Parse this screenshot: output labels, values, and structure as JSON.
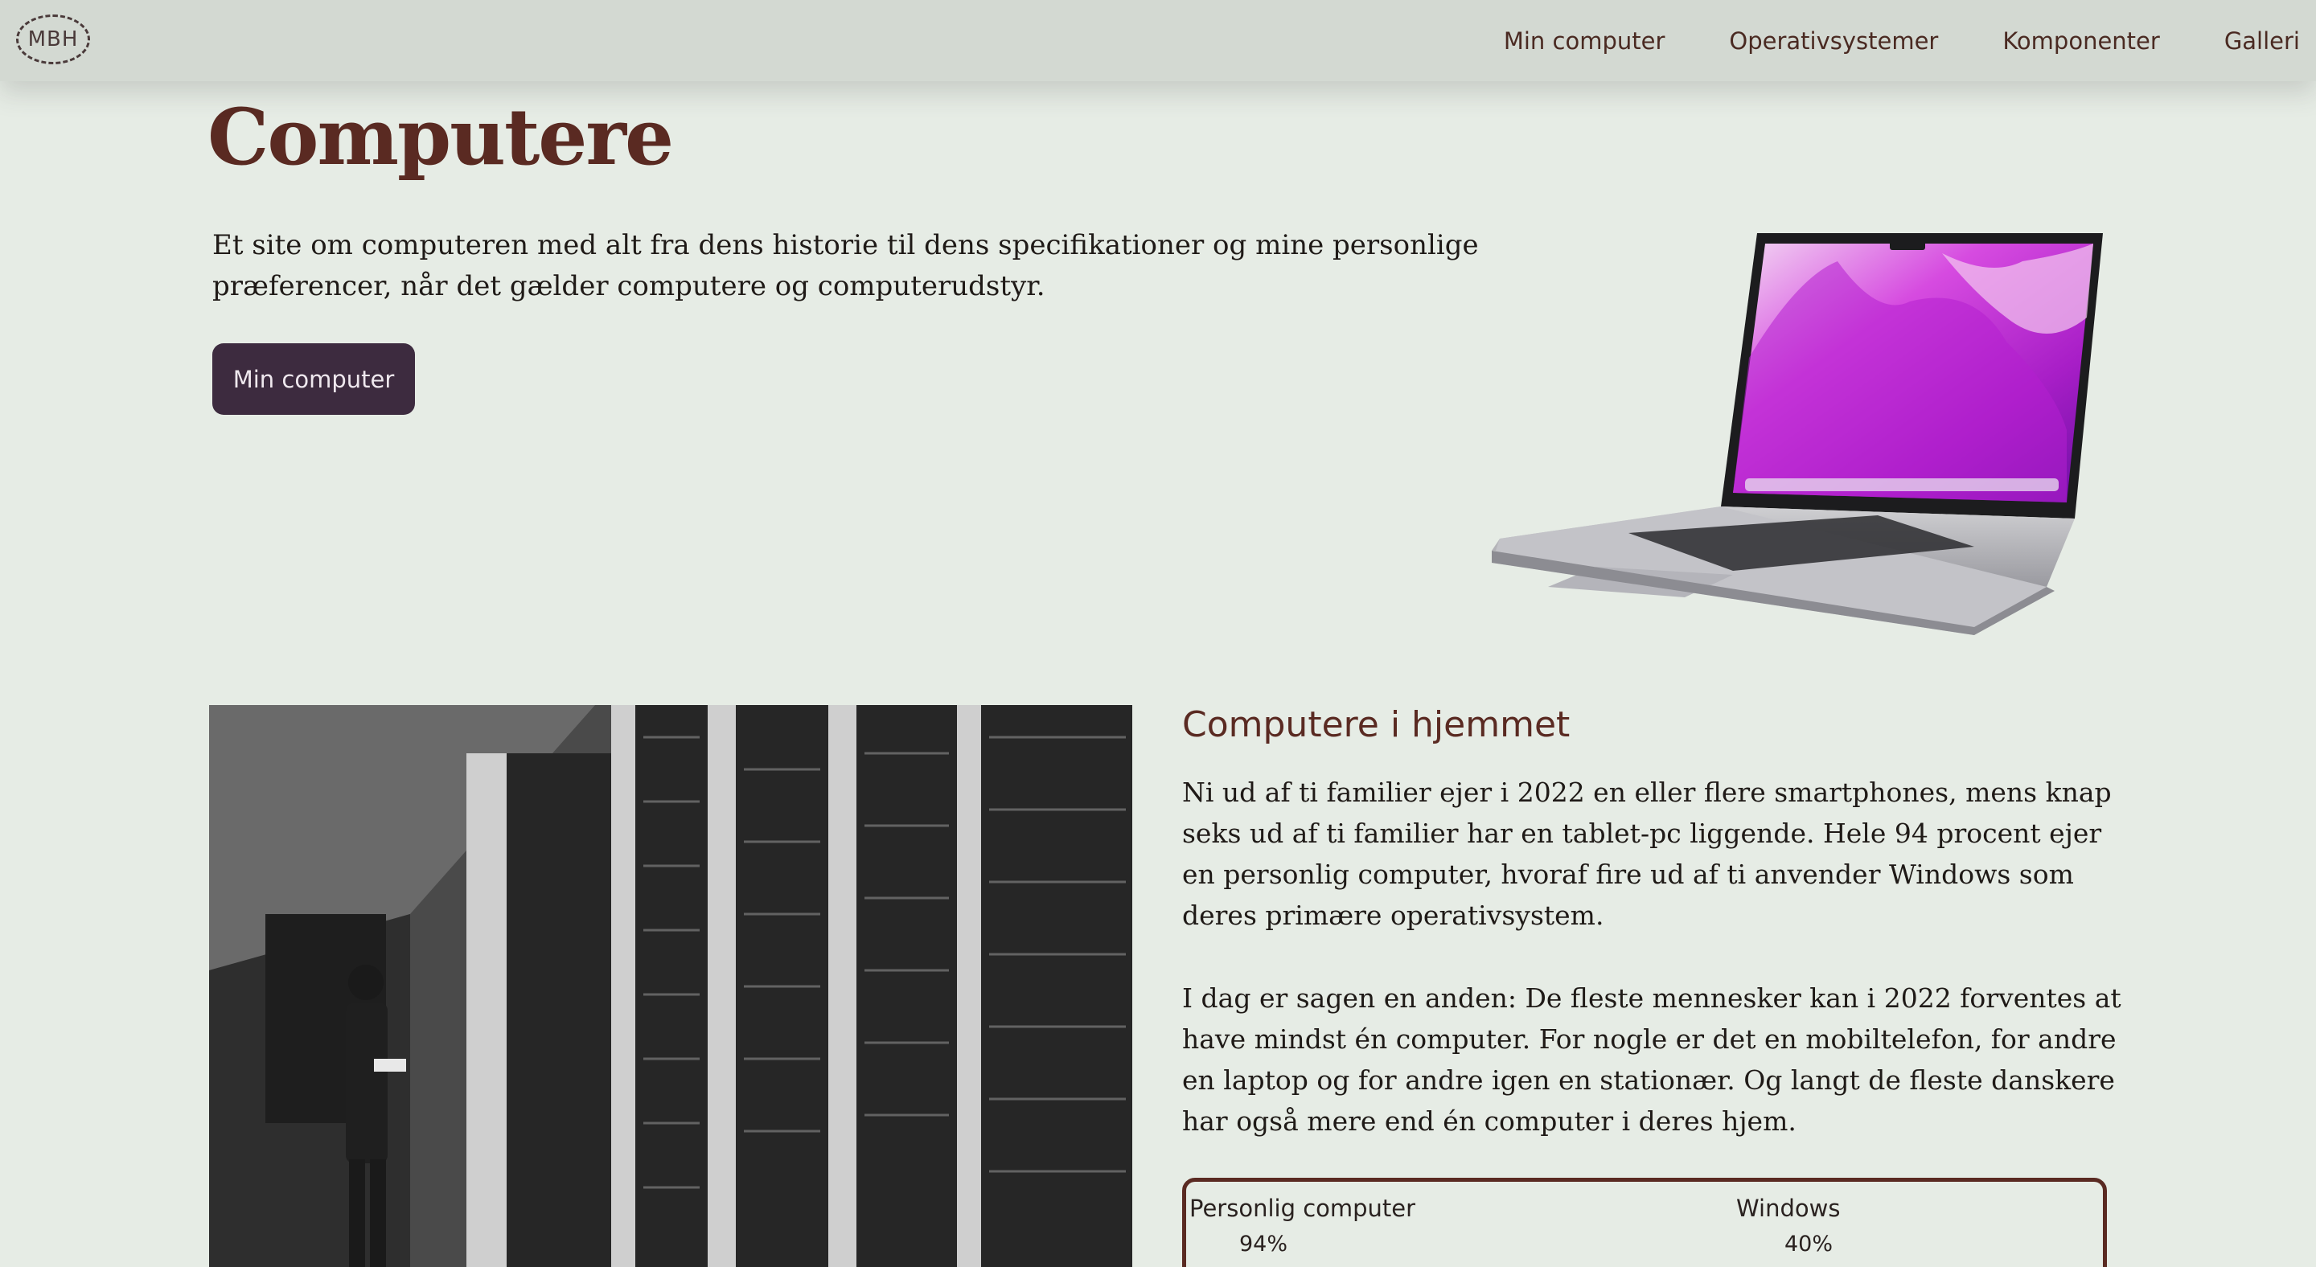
{
  "nav": {
    "logo": "MBH",
    "links": [
      "Min computer",
      "Operativsystemer",
      "Komponenter",
      "Galleri"
    ]
  },
  "hero": {
    "title": "Computere",
    "text": "Et site om computeren med alt fra dens historie til dens specifikationer og mine personlige præferencer, når det gælder computere og computerudstyr.",
    "button_label": "Min computer"
  },
  "home_section": {
    "heading": "Computere i hjemmet",
    "paragraph1": "Ni ud af ti familier ejer i 2022 en eller flere smartphones, mens knap seks ud af ti familier har en tablet-pc liggende. Hele 94 procent ejer en personlig computer, hvoraf fire ud af ti anvender Windows som deres primære operativsystem.",
    "paragraph2": "I dag er sagen en anden: De fleste mennesker kan i 2022 forventes at have mindst én computer. For nogle er det en mobiltelefon, for andre en laptop og for andre igen en stationær. Og langt de fleste danskere har også mere end én computer i deres hjem.",
    "stats": [
      {
        "label": "Personlig computer",
        "value": "94%"
      },
      {
        "label": "Windows",
        "value": "40%"
      }
    ]
  },
  "colors": {
    "background": "#e6ece5",
    "nav_background": "#d3d9d2",
    "accent_brown": "#5a2a22",
    "button_purple": "#3d2b3f"
  }
}
